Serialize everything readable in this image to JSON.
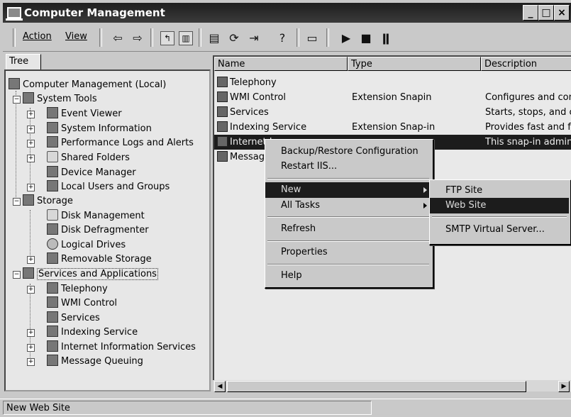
{
  "window": {
    "title": "Computer Management",
    "controls": [
      "_",
      "□",
      "×"
    ]
  },
  "menubar": {
    "action": "Action",
    "view": "View"
  },
  "toolbar_icons": [
    "back-icon",
    "forward-icon",
    "up-folder-icon",
    "show-hide-tree-icon",
    "properties-icon",
    "refresh-icon",
    "export-list-icon",
    "help-icon",
    "computer-icon",
    "play-icon",
    "stop-icon",
    "pause-icon"
  ],
  "tree_tab": "Tree",
  "tree": [
    {
      "label": "Computer Management (Local)",
      "icon": "computer-icon"
    },
    {
      "label": "System Tools",
      "icon": "tools-icon"
    },
    {
      "label": "Event Viewer",
      "icon": "event-viewer-icon"
    },
    {
      "label": "System Information",
      "icon": "system-info-icon"
    },
    {
      "label": "Performance Logs and Alerts",
      "icon": "performance-icon"
    },
    {
      "label": "Shared Folders",
      "icon": "shared-folders-icon"
    },
    {
      "label": "Device Manager",
      "icon": "device-manager-icon"
    },
    {
      "label": "Local Users and Groups",
      "icon": "users-icon"
    },
    {
      "label": "Storage",
      "icon": "storage-icon"
    },
    {
      "label": "Disk Management",
      "icon": "disk-management-icon"
    },
    {
      "label": "Disk Defragmenter",
      "icon": "defrag-icon"
    },
    {
      "label": "Logical Drives",
      "icon": "drive-icon"
    },
    {
      "label": "Removable Storage",
      "icon": "removable-storage-icon"
    },
    {
      "label": "Services and Applications",
      "icon": "services-apps-icon"
    },
    {
      "label": "Telephony",
      "icon": "telephony-icon"
    },
    {
      "label": "WMI Control",
      "icon": "wmi-icon"
    },
    {
      "label": "Services",
      "icon": "services-icon"
    },
    {
      "label": "Indexing Service",
      "icon": "indexing-icon"
    },
    {
      "label": "Internet Information Services",
      "icon": "iis-icon"
    },
    {
      "label": "Message Queuing",
      "icon": "message-queuing-icon"
    }
  ],
  "list": {
    "columns": [
      "Name",
      "Type",
      "Description"
    ],
    "rows": [
      {
        "name": "Telephony",
        "type": "",
        "description": ""
      },
      {
        "name": "WMI Control",
        "type": "Extension Snapin",
        "description": "Configures and cont"
      },
      {
        "name": "Services",
        "type": "",
        "description": "Starts, stops, and c"
      },
      {
        "name": "Indexing Service",
        "type": "Extension Snap-in",
        "description": "Provides fast and fle"
      },
      {
        "name": "Internet I",
        "type": "",
        "description": "This snap-in adminis"
      },
      {
        "name": "Message",
        "type": "",
        "description": ""
      }
    ]
  },
  "context_menu": {
    "items": [
      "Backup/Restore Configuration",
      "Restart IIS...",
      "New",
      "All Tasks",
      "Refresh",
      "Properties",
      "Help"
    ]
  },
  "submenu": {
    "items": [
      "FTP Site",
      "Web Site",
      "SMTP Virtual Server..."
    ]
  },
  "status": {
    "text": "New Web Site"
  }
}
